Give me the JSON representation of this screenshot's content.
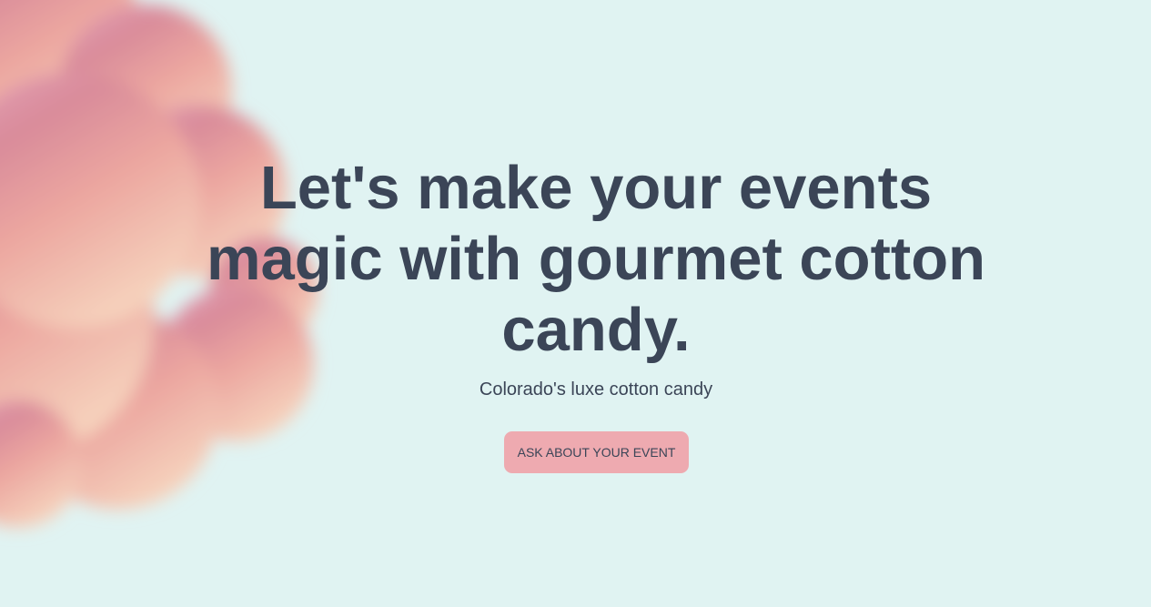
{
  "hero": {
    "headline": "Let's make your events magic with gourmet cotton candy.",
    "subheadline": "Colorado's luxe cotton candy",
    "cta_label": "ASK ABOUT YOUR EVENT"
  },
  "colors": {
    "background": "#e0f3f2",
    "text": "#3b4557",
    "cta_background": "#eeaab0",
    "cloud_pink": "#d98b9a",
    "cloud_peach": "#f2c3ae"
  },
  "decor": {
    "image": "cotton-candy-cloud"
  }
}
